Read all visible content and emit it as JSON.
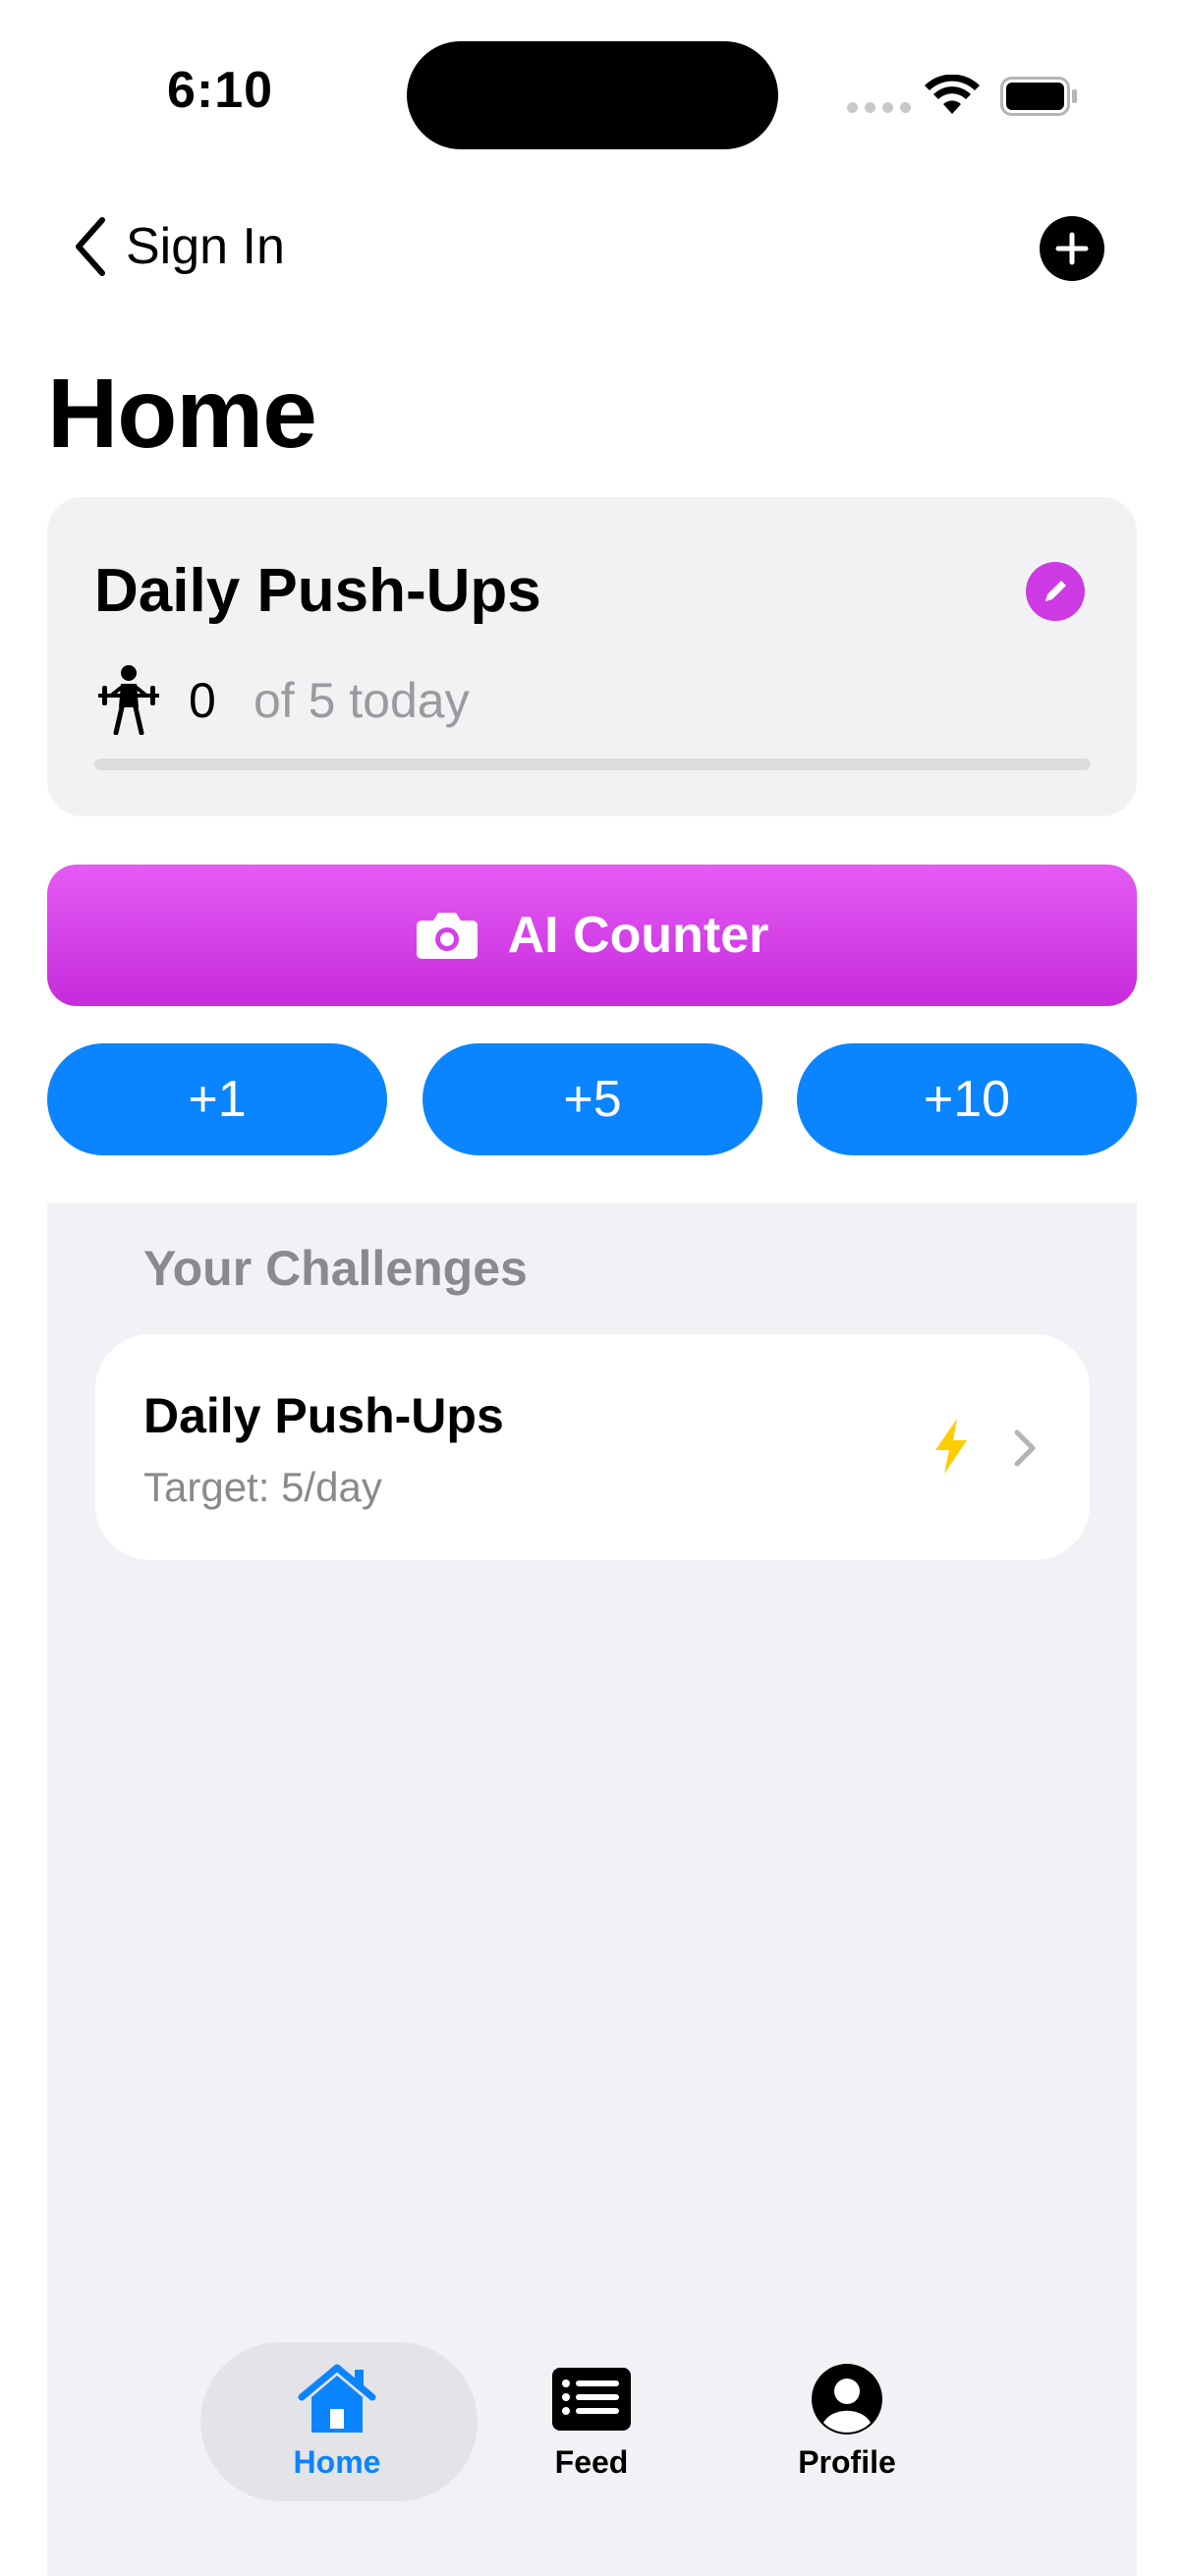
{
  "status_bar": {
    "time": "6:10"
  },
  "nav": {
    "back_label": "Sign In",
    "back_icon": "chevron-left-icon",
    "add_icon": "plus-circle-icon"
  },
  "page": {
    "title": "Home"
  },
  "card": {
    "title": "Daily Push-Ups",
    "count": "0",
    "target_text": "of 5 today",
    "progress": 0,
    "edit_icon": "pencil-icon",
    "exercise_icon": "weightlifter-icon"
  },
  "ai_counter": {
    "label": "AI Counter",
    "icon": "camera-icon"
  },
  "increments": [
    {
      "label": "+1"
    },
    {
      "label": "+5"
    },
    {
      "label": "+10"
    }
  ],
  "challenges": {
    "section_title": "Your Challenges",
    "items": [
      {
        "title": "Daily Push-Ups",
        "subtitle": "Target: 5/day"
      }
    ]
  },
  "tabs": [
    {
      "label": "Home",
      "icon": "house-icon",
      "selected": true
    },
    {
      "label": "Feed",
      "icon": "list-icon",
      "selected": false
    },
    {
      "label": "Profile",
      "icon": "person-circle-icon",
      "selected": false
    }
  ],
  "colors": {
    "accent_purple": "#cd3ae3",
    "accent_blue": "#0a84ff",
    "bolt_yellow": "#ffcc00"
  }
}
